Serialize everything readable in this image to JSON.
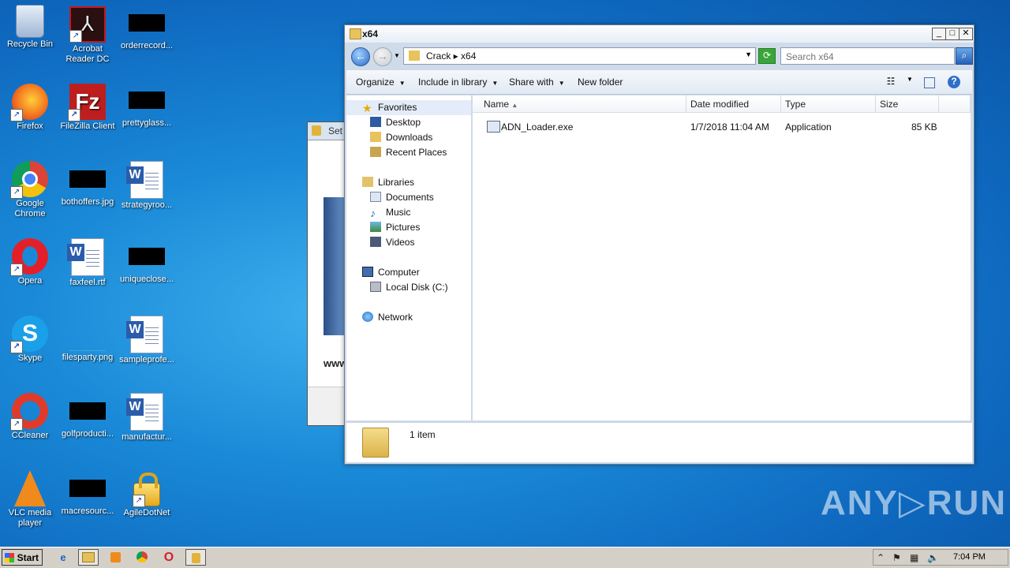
{
  "desktop": {
    "icons": [
      {
        "label": "Recycle Bin"
      },
      {
        "label": "Acrobat Reader DC"
      },
      {
        "label": "orderrecord..."
      },
      {
        "label": "Firefox"
      },
      {
        "label": "FileZilla Client"
      },
      {
        "label": "prettyglass..."
      },
      {
        "label": "Google Chrome"
      },
      {
        "label": "bothoffers.jpg"
      },
      {
        "label": "strategyroo..."
      },
      {
        "label": "Opera"
      },
      {
        "label": "faxfeel.rtf"
      },
      {
        "label": "uniqueclose..."
      },
      {
        "label": "Skype"
      },
      {
        "label": "filesparty.png"
      },
      {
        "label": "sampleprofe..."
      },
      {
        "label": "CCleaner"
      },
      {
        "label": "golfproducti..."
      },
      {
        "label": "manufactur..."
      },
      {
        "label": "VLC media player"
      },
      {
        "label": "macresourc..."
      },
      {
        "label": "AgileDotNet"
      }
    ]
  },
  "background_dialog": {
    "title": "Set",
    "url_fragment": "www"
  },
  "explorer": {
    "title": "x64",
    "address": {
      "crumbs": "Crack  ▸  x64"
    },
    "search": {
      "placeholder": "Search x64"
    },
    "toolbar": {
      "organize": "Organize",
      "include_in_library": "Include in library",
      "share_with": "Share with",
      "new_folder": "New folder"
    },
    "nav": {
      "favorites": "Favorites",
      "desktop": "Desktop",
      "downloads": "Downloads",
      "recent_places": "Recent Places",
      "libraries": "Libraries",
      "documents": "Documents",
      "music": "Music",
      "pictures": "Pictures",
      "videos": "Videos",
      "computer": "Computer",
      "local_disk": "Local Disk (C:)",
      "network": "Network"
    },
    "columns": {
      "name": "Name",
      "date_modified": "Date modified",
      "type": "Type",
      "size": "Size"
    },
    "files": [
      {
        "name": "ADN_Loader.exe",
        "date_modified": "1/7/2018 11:04 AM",
        "type": "Application",
        "size": "85 KB"
      }
    ],
    "status": "1 item"
  },
  "watermark": "ANY▷RUN",
  "taskbar": {
    "start_label": "Start",
    "clock": "7:04 PM"
  }
}
